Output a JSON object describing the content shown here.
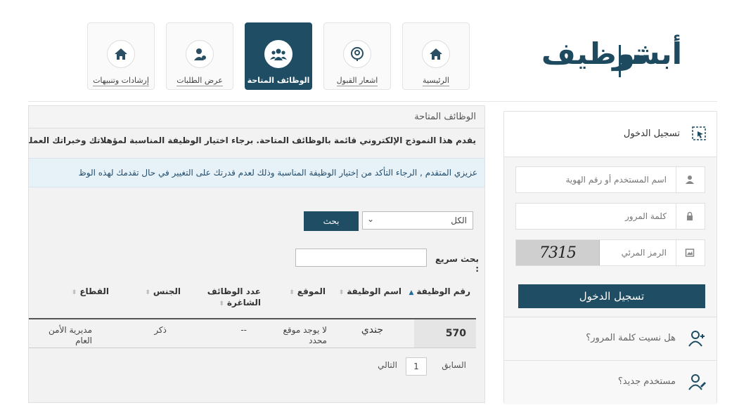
{
  "logo": {
    "left": "أبشر",
    "right": "توظيف"
  },
  "nav": {
    "items": [
      {
        "label": "الرئيسية",
        "icon": "home-icon"
      },
      {
        "label": "اشعار القبول",
        "icon": "notice-icon"
      },
      {
        "label": "الوظائف المتاحة",
        "icon": "group-icon",
        "active": true
      },
      {
        "label": "عرض الطلبات",
        "icon": "person-icon"
      },
      {
        "label": "إرشادات وتنبيهات",
        "icon": "home-icon"
      }
    ]
  },
  "jobs": {
    "title": "الوظائف المتاحة",
    "intro": "يقدم هذا النموذج الإلكتروني قائمة بالوظائف المتاحة. برجاء اختيار الوظيفة المناسبة لمؤهلاتك وخبراتك العملية وأبدأ",
    "notice": "عزيزي المتقدم , الرجاء التأكد من إختيار الوظيفة المناسبة وذلك لعدم قدرتك على التغيير في حال تقدمك لهذه الوظ",
    "filter_value": "الكل",
    "search_label": "بحث",
    "quick_search_label": "بحث سريع :",
    "columns": [
      "رقم الوظيفة",
      "اسم الوظيفة",
      "الموقع",
      "عدد الوظائف الشاغرة",
      "الجنس",
      "القطاع"
    ],
    "rows": [
      {
        "id": "570",
        "name": "جندي",
        "location": "لا يوجد موقع محدد",
        "vacancies": "--",
        "gender": "ذكر",
        "sector": "مديرية الأمن العام"
      }
    ],
    "pager": {
      "prev": "السابق",
      "page": "1",
      "next": "التالي"
    }
  },
  "login": {
    "title": "تسجيل الدخول",
    "username_placeholder": "اسم المستخدم أو رقم الهوية",
    "password_placeholder": "كلمة المرور",
    "captcha_placeholder": "الرمز المرئي",
    "captcha_value": "7315",
    "button": "تسجيل الدخول",
    "forgot": "هل نسيت كلمة المرور؟",
    "new_user": "مستخدم جديد؟"
  },
  "colors": {
    "primary": "#1f4d63",
    "panel": "#f2f2f2",
    "notice_bg": "#e7f1f8"
  }
}
